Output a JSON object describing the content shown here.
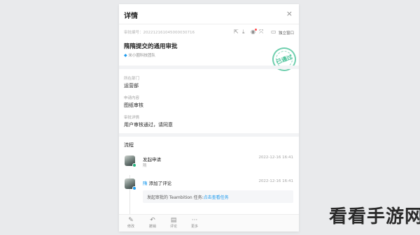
{
  "panel": {
    "title": "详情",
    "close_icon": "×"
  },
  "meta": {
    "serial_label": "审批编号：",
    "serial_value": "202212161045000030716"
  },
  "toolbar": {
    "share_icon": "⇱",
    "download_icon": "⤓",
    "view_icon": "◉",
    "link_icon": "⤧",
    "window_icon": "▭",
    "window_label": "独立窗口"
  },
  "approval": {
    "title": "隋隋提交的通用审批",
    "tag": "米小圈科技团队",
    "tag_icon": "◆",
    "stamp": "已通过"
  },
  "fields": [
    {
      "label": "所在部门",
      "value": "运营部"
    },
    {
      "label": "申请内容",
      "value": "图纸审核"
    },
    {
      "label": "审批详情",
      "value": "用户审核通过，请同意"
    }
  ],
  "process": {
    "section_title": "流程",
    "step1": {
      "title": "发起申请",
      "sub": "隋",
      "time": "2022-12-16 16:41",
      "badge_icon": "check"
    },
    "step2": {
      "actor": "隋",
      "action": "添加了评论",
      "time": "2022-12-16 16:41",
      "badge_icon": "comment",
      "comment_prefix": "发起审批的 Teambition 任务:",
      "comment_link": "点击查看任务"
    }
  },
  "bottom_bar": [
    {
      "icon": "✎",
      "label": "修改"
    },
    {
      "icon": "↶",
      "label": "撤销"
    },
    {
      "icon": "▤",
      "label": "评论"
    },
    {
      "icon": "···",
      "label": "更多"
    }
  ],
  "watermark": "看看手游网",
  "colors": {
    "accent": "#1b9aee",
    "stamp": "#3fbf93",
    "success": "#22b07a"
  }
}
